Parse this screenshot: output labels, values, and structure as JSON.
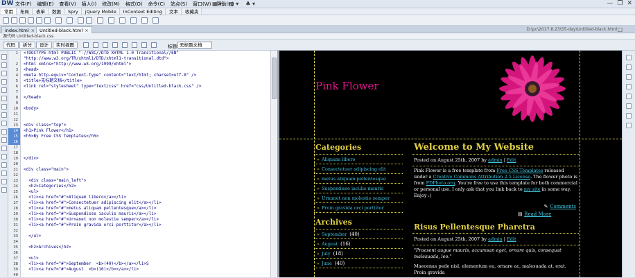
{
  "app": {
    "logo": "DW",
    "menu": [
      "文件(F)",
      "编辑(E)",
      "查看(V)",
      "插入(I)",
      "修改(M)",
      "格式(O)",
      "命令(C)",
      "站点(S)",
      "窗口(W)",
      "帮助(H)"
    ],
    "toolbar_icons": [
      "▦ ▾",
      "▥ ▾",
      "♣ ▾"
    ],
    "window_controls": [
      "—",
      "❐",
      "✕"
    ]
  },
  "insert_tabs": [
    "常用",
    "布局",
    "表单",
    "数据",
    "Spry",
    "jQuery Mobile",
    "InContext Editing",
    "文本",
    "收藏夹"
  ],
  "insert_tab_active": 0,
  "documents": {
    "tabs": [
      {
        "label": "index.html",
        "close": "×"
      },
      {
        "label": "Untitled-black.html",
        "close": "×"
      }
    ],
    "active": 1,
    "path": "D:\\pc\\2017.8.23\\55-day\\Untitled-black.html",
    "close_all": "□"
  },
  "source_bar": "源代码  Untitled-black.css",
  "view": {
    "buttons": [
      "代码",
      "拆分",
      "设计",
      "实时视图"
    ],
    "title_label": "标题:",
    "title_value": "无标题文档"
  },
  "code": {
    "line_numbers": [
      "1",
      "",
      "2",
      "3",
      "4",
      "5",
      "6",
      "7",
      "8",
      "9",
      "10",
      "11",
      "12",
      "13",
      "14",
      "15",
      "16",
      "17",
      "18",
      "19",
      "20",
      "21",
      "22",
      "23",
      "24",
      "25",
      "26",
      "27",
      "28",
      "29",
      "30",
      "31",
      "32",
      "33",
      "34",
      "35",
      "36",
      "37",
      "38",
      "39",
      "40"
    ],
    "lines": [
      "<!DOCTYPE html PUBLIC \"-//W3C//DTD XHTML 1.0 Transitional//EN\"",
      "\"http://www.w3.org/TR/xhtml1/DTD/xhtml1-transitional.dtd\">",
      "<html xmlns=\"http://www.w3.org/1999/xhtml\">",
      "<head>",
      "<meta http-equiv=\"Content-Type\" content=\"text/html; charset=utf-8\" />",
      "<title>无标题文档</title>",
      "<link rel=\"stylesheet\" type=\"text/css\" href=\"css/Untitled-black.css\" />",
      "",
      "</head>",
      "",
      "<body>",
      "",
      "",
      "<div class=\"top\">",
      "<h1>Pink Flower</h1>",
      "<h5>By Free CSS Templates</h5>",
      "",
      "",
      "",
      "</div>",
      "",
      "<div class=\"main\">",
      "",
      "  <div class=\"main_left\">",
      "  <h2>Categories</h2>",
      "  <ul>",
      "  <li><a href=\"#\">Aliquam libero</a></li>",
      "  <li><a href=\"#\">Consectetuer adipiscing elit</a></li>",
      "  <li><a href=\"#\">metus aliquam pellentesque</a></li>",
      "  <li><a href=\"#\">Suspendisse iaculis mauris</a></li>",
      "  <li><a href=\"#\">Urnanet non molestie semper</a></li>",
      "  <li><a href=\"#\">Proin gravida orci porttitor</a></li>",
      "",
      "  </ul>",
      "",
      "  <h2>Archives</h2>",
      "",
      "  <ul>",
      "  <li><a href=\"#\">September  <b>(40)</b></a></li>S",
      "  <li><a href=\"#\">August  <b>(16)</b></a></li>",
      ""
    ]
  },
  "site": {
    "title": "Pink Flower",
    "categories_heading": "Categories",
    "categories": [
      "Aliquam libero",
      "Consectetuer adipiscing elit",
      "metus aliquam pellentesque",
      "Suspendisse iaculis mauris",
      "Urnanet non molestie semper",
      "Proin gravida orci porttitor"
    ],
    "archives_heading": "Archives",
    "archives": [
      {
        "month": "September",
        "count": "(40)"
      },
      {
        "month": "August",
        "count": "(16)"
      },
      {
        "month": "July",
        "count": "(18)"
      },
      {
        "month": "June",
        "count": "(40)"
      }
    ],
    "post1": {
      "heading": "Welcome to My Website",
      "meta_prefix": "Posted on August 25th, 2007 by ",
      "meta_author": "admin",
      "meta_sep": " | ",
      "meta_edit": "Edit",
      "p1_a": "Pink Flower is a free template from ",
      "p1_link1": "Free CSS Templates",
      "p1_b": " released under a ",
      "p1_link2": "Creative Commons Attribution 2.5 License",
      "p1_c": ". The flower photo is from ",
      "p1_link3": "PDPhoto.org",
      "p1_d": ". You're free to use this template for both commercial or personal use. I only ask that you link back to ",
      "p1_link4": "my site",
      "p1_e": " in some way. Enjoy :)",
      "comments": "Comments",
      "read_more": "Read More"
    },
    "post2": {
      "heading": "Risus Pellentesque Pharetra",
      "meta_prefix": "Posted on August 25th, 2007 by ",
      "meta_author": "admin",
      "meta_sep": " | ",
      "meta_edit": "Edit",
      "quote": "\"Praesent augue mauris, accumsan eget, ornare quis, consequat malesuada, leo.\"",
      "text": "Maecenas pede nisl, elementum eu, ornare ac, malesuada at, erat. Proin gravida"
    }
  }
}
